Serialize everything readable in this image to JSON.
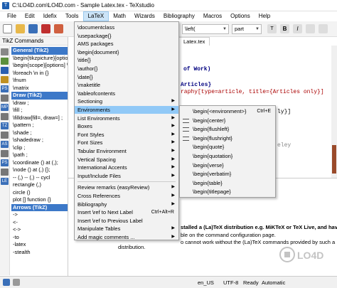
{
  "window": {
    "title": "C:\\LO4D.com\\LO4D.com - Sample Latex.tex - TeXstudio"
  },
  "menubar": [
    "File",
    "Edit",
    "Idefix",
    "Tools",
    "LaTeX",
    "Math",
    "Wizards",
    "Bibliography",
    "Macros",
    "Options",
    "Help"
  ],
  "toolbar": {
    "combo1": "\\left(",
    "combo2": "part"
  },
  "left_panel": {
    "title": "TikZ Commands",
    "items": [
      {
        "label": "General (TikZ)",
        "group": true
      },
      {
        "label": "\\begin{tikzpicture}[options]",
        "group": false
      },
      {
        "label": "\\begin{scope}[options] \\e",
        "group": false
      },
      {
        "label": "\\foreach \\n in {}",
        "group": false
      },
      {
        "label": "\\fnum",
        "group": false
      },
      {
        "label": "\\matrix",
        "group": false
      },
      {
        "label": "Draw (TikZ)",
        "group": true
      },
      {
        "label": "\\draw ;",
        "group": false
      },
      {
        "label": "\\fill ;",
        "group": false
      },
      {
        "label": "\\filldraw[fill=, draw=] ;",
        "group": false
      },
      {
        "label": "\\pattern ;",
        "group": false
      },
      {
        "label": "\\shade ;",
        "group": false
      },
      {
        "label": "\\shadedraw ;",
        "group": false
      },
      {
        "label": "\\clip ;",
        "group": false
      },
      {
        "label": "\\path ;",
        "group": false
      },
      {
        "label": "\\coordinate () at (,);",
        "group": false
      },
      {
        "label": "\\node () at (,) {};",
        "group": false
      },
      {
        "label": "-- (,) -- (,) -- cycl",
        "group": false
      },
      {
        "label": "rectangle (,)",
        "group": false
      },
      {
        "label": "circle ()",
        "group": false
      },
      {
        "label": "plot [] function {}",
        "group": false
      },
      {
        "label": "Arrows (TikZ)",
        "group": true
      },
      {
        "label": "->",
        "group": false
      },
      {
        "label": "<-",
        "group": false
      },
      {
        "label": "<->",
        "group": false
      },
      {
        "label": "-to",
        "group": false
      },
      {
        "label": "-latex",
        "group": false
      },
      {
        "label": "-stealth",
        "group": false
      }
    ]
  },
  "side_icons": [
    "",
    "",
    "",
    "",
    "PS",
    "",
    "MP",
    "",
    "TZ",
    "",
    "AS",
    "",
    "PS",
    "",
    "LE"
  ],
  "editor": {
    "tab": "Latex.tex",
    "lines": [
      {
        "text": "of Work)"
      },
      {
        "text": "Articles}"
      },
      {
        "text": "raphy[type=article, title={Articles only}]"
      },
      {
        "text": "ly}]"
      },
      {
        "text": "eley"
      }
    ]
  },
  "menu": {
    "items": [
      {
        "label": "\\documentclass",
        "shortcut": "",
        "sub": false,
        "sep_before": false
      },
      {
        "label": "\\usepackage{}",
        "shortcut": "",
        "sub": false,
        "sep_before": false
      },
      {
        "label": "AMS packages",
        "shortcut": "",
        "sub": false,
        "sep_before": false
      },
      {
        "label": "\\begin{document}",
        "shortcut": "",
        "sub": false,
        "sep_before": false
      },
      {
        "label": "\\title{}",
        "shortcut": "",
        "sub": false,
        "sep_before": false
      },
      {
        "label": "\\author{}",
        "shortcut": "",
        "sub": false,
        "sep_before": false
      },
      {
        "label": "\\date{}",
        "shortcut": "",
        "sub": false,
        "sep_before": false
      },
      {
        "label": "\\maketitle",
        "shortcut": "",
        "sub": false,
        "sep_before": false
      },
      {
        "label": "\\tableofcontents",
        "shortcut": "",
        "sub": false,
        "sep_before": false
      },
      {
        "label": "Sectioning",
        "shortcut": "",
        "sub": true,
        "sep_before": false
      },
      {
        "label": "Environments",
        "shortcut": "",
        "sub": true,
        "sep_before": false,
        "highlight": true
      },
      {
        "label": "List Environments",
        "shortcut": "",
        "sub": true,
        "sep_before": false
      },
      {
        "label": "Boxes",
        "shortcut": "",
        "sub": true,
        "sep_before": false
      },
      {
        "label": "Font Styles",
        "shortcut": "",
        "sub": true,
        "sep_before": false
      },
      {
        "label": "Font Sizes",
        "shortcut": "",
        "sub": true,
        "sep_before": false
      },
      {
        "label": "Tabular Environment",
        "shortcut": "",
        "sub": true,
        "sep_before": false
      },
      {
        "label": "Vertical Spacing",
        "shortcut": "",
        "sub": true,
        "sep_before": false
      },
      {
        "label": "International Accents",
        "shortcut": "",
        "sub": true,
        "sep_before": false
      },
      {
        "label": "Input/Include Files",
        "shortcut": "",
        "sub": true,
        "sep_before": false
      },
      {
        "label": "Review remarks (easyReview)",
        "shortcut": "",
        "sub": true,
        "sep_before": true
      },
      {
        "label": "Cross References",
        "shortcut": "",
        "sub": true,
        "sep_before": false
      },
      {
        "label": "Bibliography",
        "shortcut": "",
        "sub": true,
        "sep_before": false
      },
      {
        "label": "Insert \\ref to Next Label",
        "shortcut": "Ctrl+Alt+R",
        "sub": false,
        "sep_before": false
      },
      {
        "label": "Insert \\ref to Previous Label",
        "shortcut": "",
        "sub": false,
        "sep_before": false
      },
      {
        "label": "Manipulate Tables",
        "shortcut": "",
        "sub": true,
        "sep_before": false
      },
      {
        "label": "Add magic comments ...",
        "shortcut": "",
        "sub": true,
        "sep_before": false
      }
    ]
  },
  "submenu": {
    "items": [
      {
        "label": "\\begin{<environment>}",
        "shortcut": "Ctrl+E"
      },
      {
        "label": "\\begin{center}",
        "shortcut": ""
      },
      {
        "label": "\\begin{flushleft}",
        "shortcut": ""
      },
      {
        "label": "\\begin{flushright}",
        "shortcut": ""
      },
      {
        "label": "\\begin{quote}",
        "shortcut": ""
      },
      {
        "label": "\\begin{quotation}",
        "shortcut": ""
      },
      {
        "label": "\\begin{verse}",
        "shortcut": ""
      },
      {
        "label": "\\begin{verbatim}",
        "shortcut": ""
      },
      {
        "label": "\\begin{table}",
        "shortcut": ""
      },
      {
        "label": "\\begin{titlepage}",
        "shortcut": ""
      }
    ]
  },
  "bottom": {
    "line1": "stalled a (La)TeX distribution e.g. MiKTeX or TeX Live, and have set",
    "line2": "ble on the command configuration page.",
    "line3": "o cannot work without the (La)TeX commands provided by such a",
    "line4": "distribution."
  },
  "status": {
    "lang": "en_US",
    "encoding": "UTF-8",
    "state": "Ready",
    "mode": "Automatic"
  },
  "colors": {
    "menu_highlight": "#91c9f7",
    "group_header": "#3c78c8",
    "scroll_thumb": "#9a4a2a"
  }
}
